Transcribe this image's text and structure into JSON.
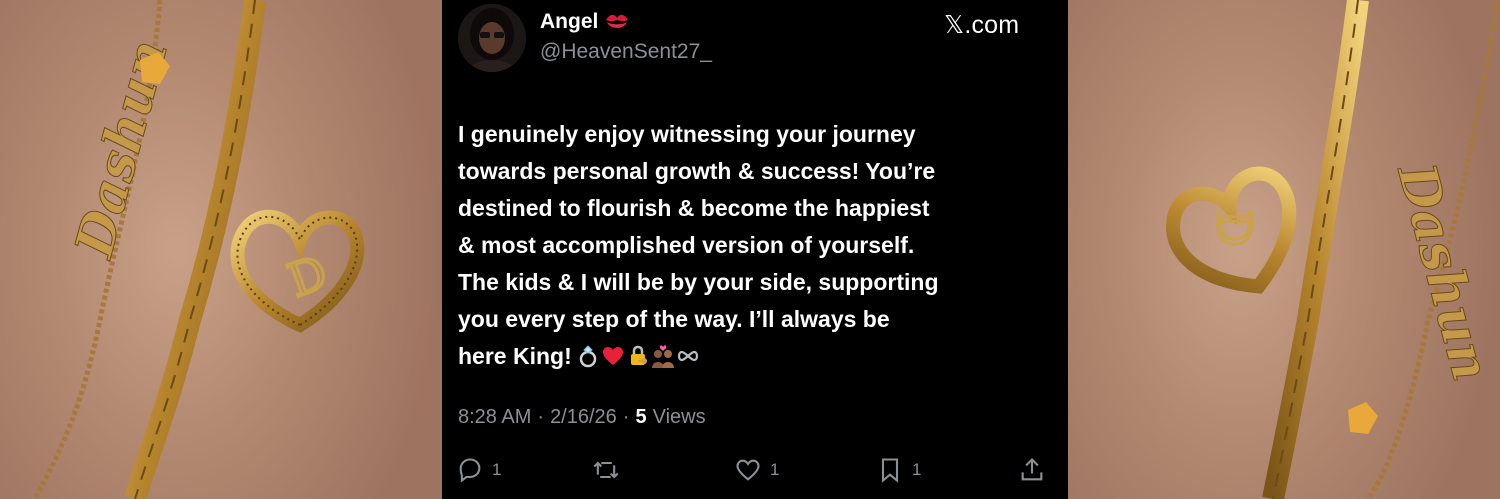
{
  "tweet": {
    "author_name": "Angel",
    "author_handle": "@HeavenSent27_",
    "site": "𝕏.com",
    "text": "I genuinely enjoy witnessing your journey\ntowards personal growth & success! You’re\ndestined to flourish & become the happiest\n& most accomplished version of yourself.\nThe kids & I will be by your side, supporting\nyou every step of the way. I’ll always be\nhere King!",
    "emojis": [
      "ring-icon",
      "red-heart-icon",
      "locked-with-key-icon",
      "couple-with-heart-icon",
      "infinity-icon"
    ],
    "time": "8:28 AM",
    "date": "2/16/26",
    "separator": "·",
    "views_count": "5",
    "views_label": "Views",
    "author_emoji": "kiss-mark-icon"
  },
  "actions": {
    "reply_count": "1",
    "retweet_count": "",
    "like_count": "1",
    "bookmark_count": "1",
    "share_count": ""
  },
  "photos": {
    "left_bracelet_name": "Dashun",
    "left_charm_letter": "D",
    "right_bracelet_name": "Dashun",
    "right_charm_letter": "D"
  },
  "colors": {
    "background": "#000000",
    "text_primary": "#ffffff",
    "text_secondary": "#8b9096",
    "gold": "#c9a24a",
    "skin": "#b48a72"
  }
}
